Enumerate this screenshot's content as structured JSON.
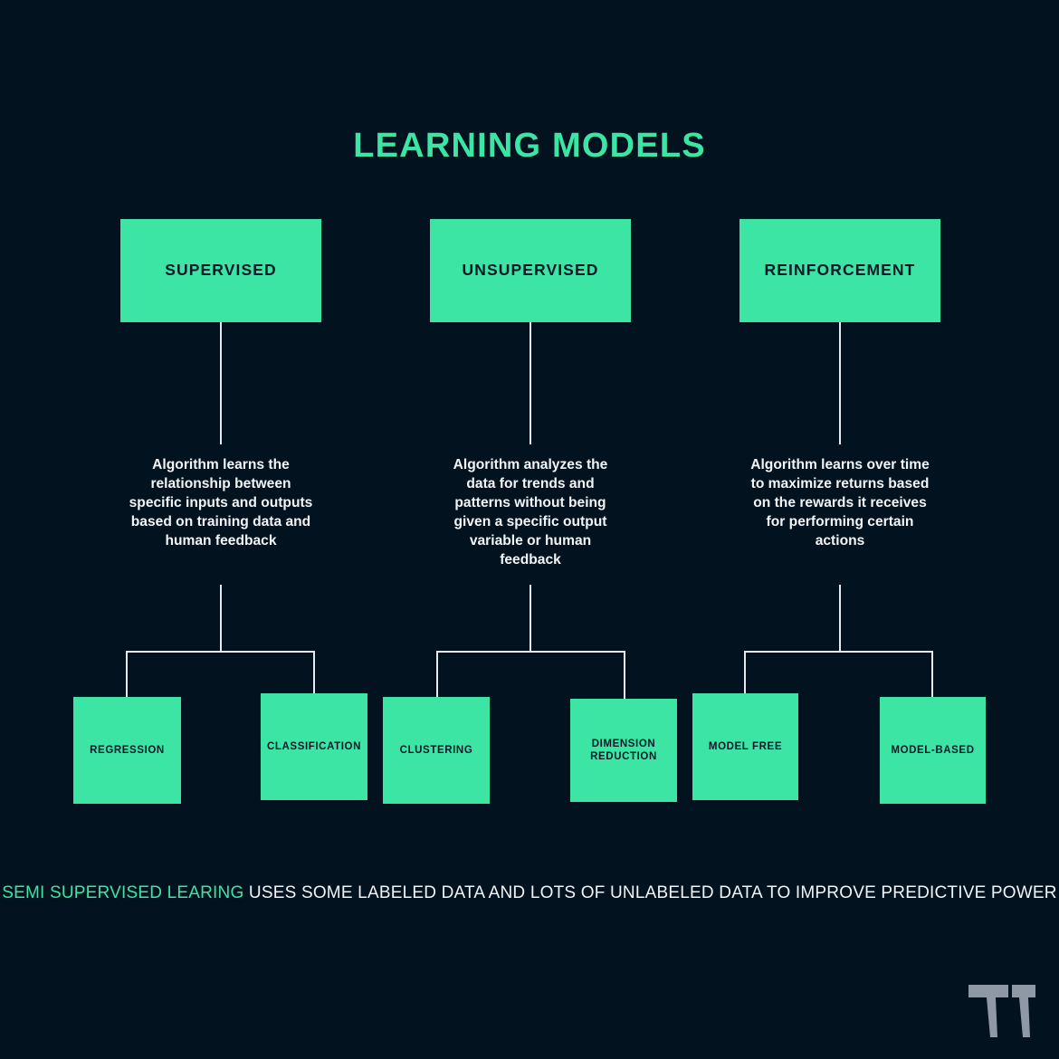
{
  "page": {
    "title": "LEARNING MODELS",
    "background_color": "#03121f",
    "accent_color": "#3ce5a4",
    "text_color": "#f2f5f8",
    "box_text_color": "#081a28",
    "connector_color": "#e6eaf0",
    "logo_color": "#8f99a6"
  },
  "columns": [
    {
      "heading": "SUPERVISED",
      "description": "Algorithm learns the relationship between specific inputs and outputs based on training data and human feedback",
      "children": [
        {
          "label": "REGRESSION"
        },
        {
          "label": "CLASSIFICATION"
        }
      ]
    },
    {
      "heading": "UNSUPERVISED",
      "description": "Algorithm analyzes the data for trends and patterns without being given a specific output variable or human feedback",
      "children": [
        {
          "label": "CLUSTERING"
        },
        {
          "label": "DIMENSION REDUCTION"
        }
      ]
    },
    {
      "heading": "REINFORCEMENT",
      "description": "Algorithm learns over time to maximize returns based on the rewards it receives for performing certain actions",
      "children": [
        {
          "label": "MODEL FREE"
        },
        {
          "label": "MODEL-BASED"
        }
      ]
    }
  ],
  "footer": {
    "accent_text": "SEMI SUPERVISED LEARING",
    "rest_text": " USES SOME LABELED DATA AND LOTS OF UNLABELED DATA TO IMPROVE PREDICTIVE POWER"
  },
  "logo": {
    "name": "tt-logo",
    "label": "TT"
  }
}
